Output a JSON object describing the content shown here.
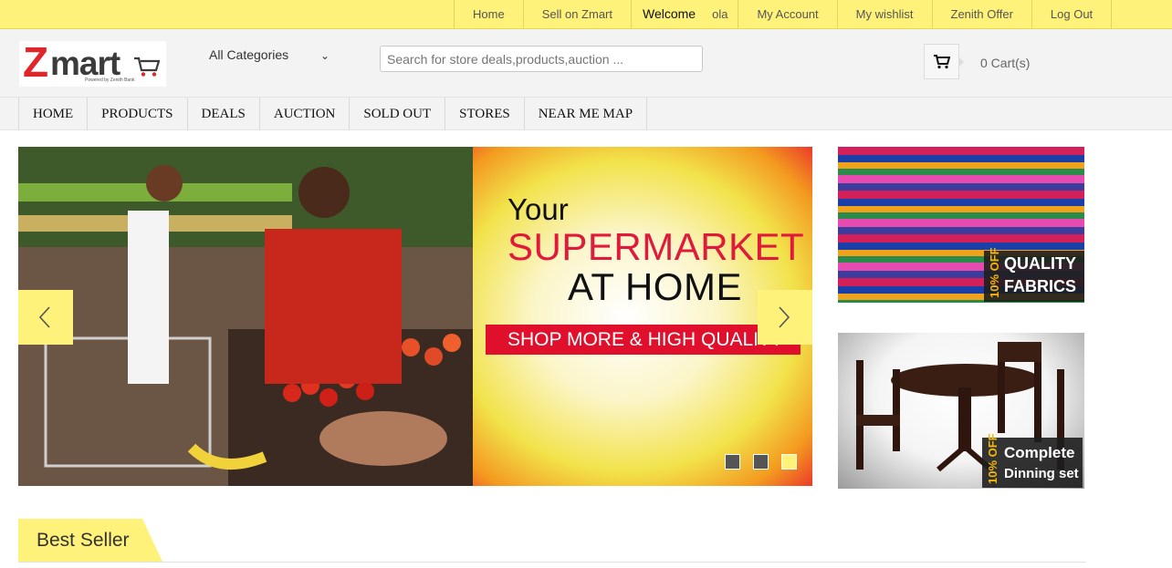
{
  "topbar": {
    "items": [
      {
        "label": "Home"
      },
      {
        "label": "Sell on Zmart"
      },
      {
        "label": "My Account"
      },
      {
        "label": "My wishlist"
      },
      {
        "label": "Zenith Offer"
      },
      {
        "label": "Log Out"
      }
    ],
    "welcome": "Welcome",
    "username": "ola",
    "color": "#fff27a"
  },
  "header": {
    "logo": {
      "z": "Z",
      "rest": "mart",
      "tagline": "Powered by Zenith Bank"
    },
    "category": "All Categories",
    "category_chevron_icon": "chevron-down-icon",
    "search_placeholder": "Search for store deals,products,auction ...",
    "cart_icon": "cart-icon",
    "cart_label": "0 Cart(s)"
  },
  "mainnav": {
    "items": [
      {
        "label": "HOME"
      },
      {
        "label": "PRODUCTS"
      },
      {
        "label": "DEALS"
      },
      {
        "label": "AUCTION"
      },
      {
        "label": "SOLD OUT"
      },
      {
        "label": "STORES"
      },
      {
        "label": "NEAR ME MAP"
      }
    ]
  },
  "slider": {
    "line1": "Your",
    "line2": "SUPERMARKET",
    "line3": "AT HOME",
    "strip": "SHOP MORE & HIGH QUALITY",
    "prev_icon": "chevron-left-icon",
    "next_icon": "chevron-right-icon",
    "active_dot": 3,
    "dot_count": 3
  },
  "banners": [
    {
      "off": "10% OFF",
      "line1": "QUALITY",
      "line2": "FABRICS"
    },
    {
      "off": "10% OFF",
      "line1": "Complete",
      "line2": "Dinning set"
    }
  ],
  "bestseller": {
    "title": "Best Seller"
  }
}
